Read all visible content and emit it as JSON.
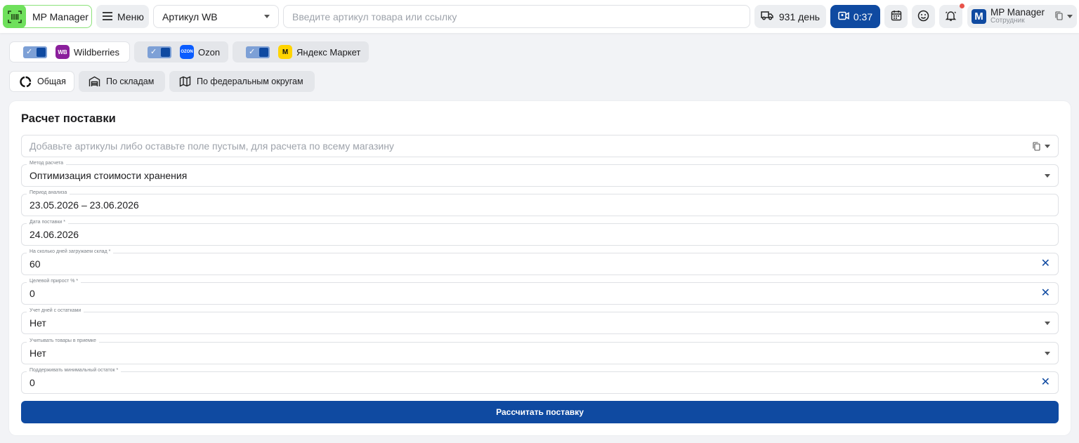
{
  "app": {
    "logo_label": "MP Manager",
    "menu_label": "Меню",
    "sku_select_value": "Артикул WB",
    "search_placeholder": "Введите артикул товара или ссылку",
    "delivery_label": "931 день",
    "timer_label": "0:37",
    "user_initial": "M",
    "user_name": "MP Manager",
    "user_role": "Сотрудник"
  },
  "marketplaces": [
    {
      "name": "Wildberries",
      "logo": "WB",
      "enabled": true
    },
    {
      "name": "Ozon",
      "logo": "OZON",
      "enabled": true
    },
    {
      "name": "Яндекс Маркет",
      "logo": "M",
      "enabled": true
    }
  ],
  "tabs": [
    {
      "label": "Общая",
      "icon": "donut-icon"
    },
    {
      "label": "По складам",
      "icon": "warehouse-icon"
    },
    {
      "label": "По федеральным округам",
      "icon": "map-icon"
    }
  ],
  "form": {
    "title": "Расчет поставки",
    "articles_placeholder": "Добавьте артикулы либо оставьте поле пустым, для расчета по всему магазину",
    "fields": [
      {
        "label": "Метод расчета",
        "value": "Оптимизация стоимости хранения"
      },
      {
        "label": "Период анализа",
        "value": "23.05.2026 – 23.06.2026"
      },
      {
        "label": "Дата поставки *",
        "value": "24.06.2026"
      },
      {
        "label": "На сколько дней загружаем склад *",
        "value": "60"
      },
      {
        "label": "Целевой прирост % *",
        "value": "0"
      },
      {
        "label": "Учет дней с остатками",
        "value": "Нет"
      },
      {
        "label": "Учитывать товары в приемке",
        "value": "Нет"
      },
      {
        "label": "Поддерживать минимальный остаток *",
        "value": "0"
      }
    ],
    "submit_label": "Рассчитать поставку"
  },
  "colors": {
    "accent": "#0f4aa1",
    "logo_green": "#6fe05c",
    "notification_dot": "#e8534a"
  }
}
